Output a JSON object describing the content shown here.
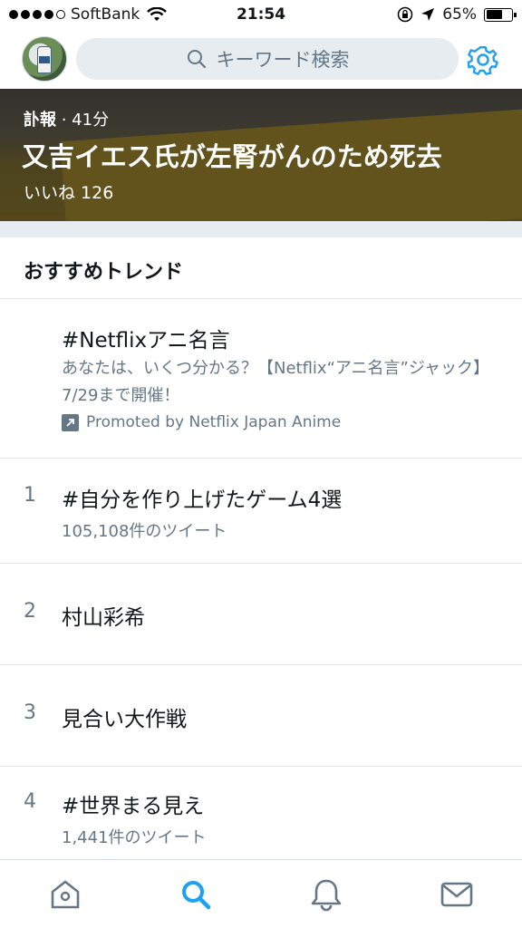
{
  "status_bar": {
    "carrier": "SoftBank",
    "time": "21:54",
    "battery_percent": "65%",
    "battery_level": 0.65
  },
  "header": {
    "search_placeholder": "キーワード検索"
  },
  "banner": {
    "category": "訃報",
    "time_ago": "· 41分",
    "title": "又吉イエス氏が左腎がんのため死去",
    "likes": "いいね 126"
  },
  "section": {
    "title": "おすすめトレンド"
  },
  "promoted_trend": {
    "name": "#Netflixアニ名言",
    "description": "あなたは、いくつ分かる？【Netflix“アニ名言”ジャック】7/29まで開催！",
    "promoted_by": "Promoted by Netflix Japan Anime"
  },
  "trends": [
    {
      "rank": "1",
      "name": "#自分を作り上げたゲーム4選",
      "tweets": "105,108件のツイート"
    },
    {
      "rank": "2",
      "name": "村山彩希",
      "tweets": ""
    },
    {
      "rank": "3",
      "name": "見合い大作戦",
      "tweets": ""
    },
    {
      "rank": "4",
      "name": "#世界まる見え",
      "tweets": "1,441件のツイート"
    }
  ],
  "tabbar": {
    "icons": [
      "home-icon",
      "search-icon",
      "notifications-icon",
      "messages-icon"
    ],
    "active_color": "#1da1f2",
    "inactive_color": "#657786"
  }
}
